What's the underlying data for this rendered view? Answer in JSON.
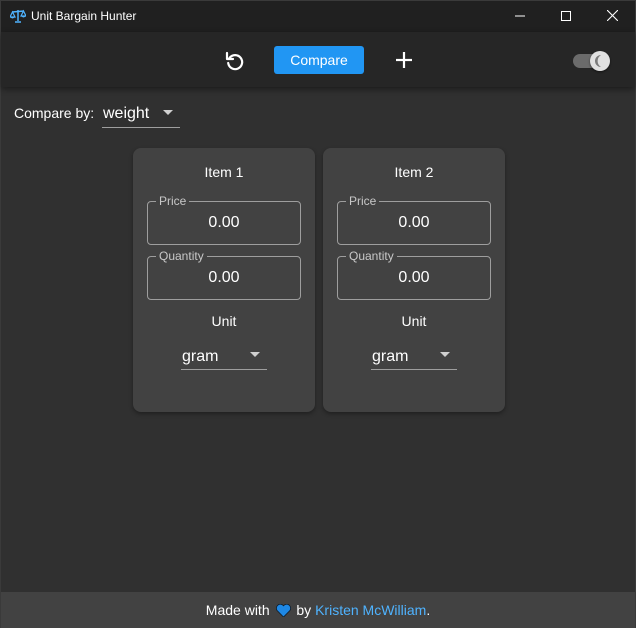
{
  "window": {
    "title": "Unit Bargain Hunter",
    "controls": [
      "minimize-icon",
      "maximize-icon",
      "close-icon"
    ]
  },
  "toolbar": {
    "reset_icon": "reset-icon",
    "compare_label": "Compare",
    "add_icon": "plus-icon",
    "theme_toggle_on": true
  },
  "compare_by": {
    "label": "Compare by:",
    "value": "weight"
  },
  "items": [
    {
      "title": "Item 1",
      "price_label": "Price",
      "price_value": "0.00",
      "quantity_label": "Quantity",
      "quantity_value": "0.00",
      "unit_label": "Unit",
      "unit_value": "gram"
    },
    {
      "title": "Item 2",
      "price_label": "Price",
      "price_value": "0.00",
      "quantity_label": "Quantity",
      "quantity_value": "0.00",
      "unit_label": "Unit",
      "unit_value": "gram"
    }
  ],
  "footer": {
    "made_with": "Made with",
    "by": "by",
    "author": "Kristen McWilliam",
    "period": "."
  },
  "colors": {
    "accent": "#2196f3",
    "link": "#4fb3ff",
    "heart": "#1e88e5",
    "background": "#303030",
    "card": "#424242"
  }
}
